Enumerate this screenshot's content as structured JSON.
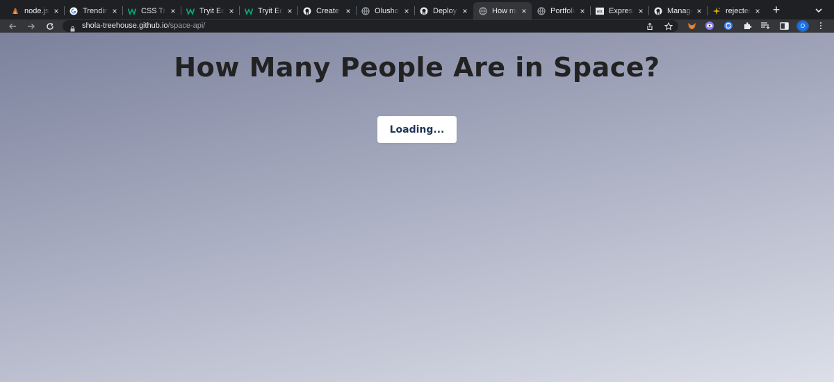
{
  "tabs": [
    {
      "title": "node.js",
      "icon": "node-favicon",
      "active": false
    },
    {
      "title": "Trending",
      "icon": "google-favicon",
      "active": false
    },
    {
      "title": "CSS Tricks",
      "icon": "w-favicon",
      "active": false
    },
    {
      "title": "Tryit Editor",
      "icon": "w-favicon",
      "active": false
    },
    {
      "title": "Tryit Editor",
      "icon": "w-favicon",
      "active": false
    },
    {
      "title": "Create",
      "icon": "github-favicon",
      "active": false
    },
    {
      "title": "Olushola",
      "icon": "globe-favicon",
      "active": false
    },
    {
      "title": "Deploy",
      "icon": "github-favicon",
      "active": false
    },
    {
      "title": "How many",
      "icon": "globe-favicon",
      "active": true
    },
    {
      "title": "Portfolio",
      "icon": "globe-favicon",
      "active": false
    },
    {
      "title": "Express",
      "icon": "ex-favicon",
      "active": false
    },
    {
      "title": "Manage",
      "icon": "github-favicon",
      "active": false
    },
    {
      "title": "rejected",
      "icon": "sparkle-favicon",
      "active": false
    }
  ],
  "address_bar": {
    "host": "shola-treehouse.github.io",
    "path": "/space-api/"
  },
  "profile": {
    "initial": "O"
  },
  "page": {
    "title": "How Many People Are in Space?",
    "status": "Loading..."
  },
  "colors": {
    "accent_profile": "#1a73e8",
    "loading_text": "#1d3557",
    "title_text": "#222222"
  }
}
